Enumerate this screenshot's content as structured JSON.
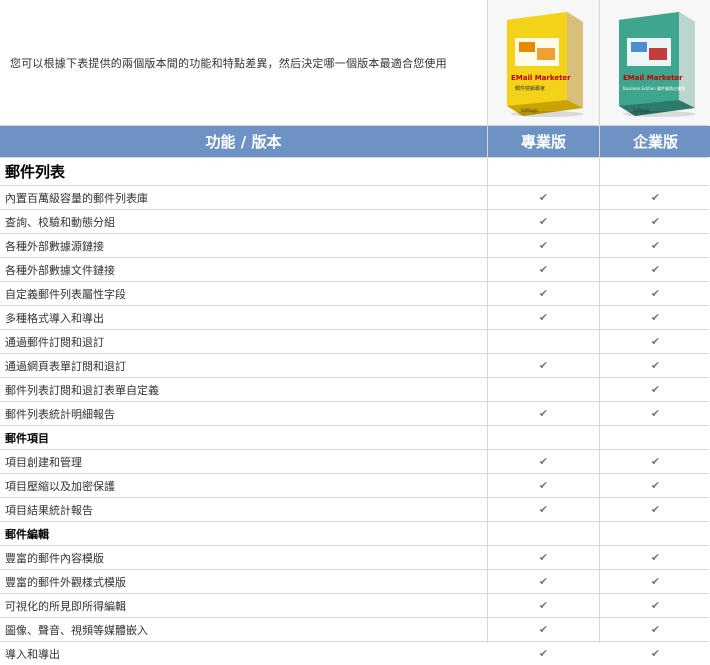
{
  "intro": "您可以根據下表提供的兩個版本間的功能和特點差異，然后決定哪一個版本最適合您使用",
  "products": [
    {
      "brand": "EMail Marketer",
      "subtitle": "郵件營銷專家",
      "vendor": "Softlogic",
      "theme": "yellow"
    },
    {
      "brand": "EMail Marketer",
      "subtitle": "Business Edition 郵件營銷企業版",
      "vendor": "Softlogic",
      "theme": "teal"
    }
  ],
  "header": {
    "feature_col": "功能 / 版本",
    "pro_col": "專業版",
    "biz_col": "企業版"
  },
  "sections": [
    {
      "title": "郵件列表",
      "big": true,
      "rows": [
        {
          "label": "內置百萬級容量的郵件列表庫",
          "pro": "✔",
          "biz": "✔"
        },
        {
          "label": "查詢、校驗和動態分組",
          "pro": "✔",
          "biz": "✔"
        },
        {
          "label": "各種外部數據源鏈接",
          "pro": "✔",
          "biz": "✔"
        },
        {
          "label": "各種外部數據文件鏈接",
          "pro": "✔",
          "biz": "✔"
        },
        {
          "label": "自定義郵件列表屬性字段",
          "pro": "✔",
          "biz": "✔"
        },
        {
          "label": "多種格式導入和導出",
          "pro": "✔",
          "biz": "✔"
        },
        {
          "label": "通過郵件訂閱和退訂",
          "pro": "",
          "biz": "✔"
        },
        {
          "label": "通過網頁表單訂閱和退訂",
          "pro": "✔",
          "biz": "✔"
        },
        {
          "label": "郵件列表訂閱和退訂表單自定義",
          "pro": "",
          "biz": "✔"
        },
        {
          "label": "郵件列表統計明細報告",
          "pro": "✔",
          "biz": "✔"
        }
      ]
    },
    {
      "title": "郵件項目",
      "big": false,
      "rows": [
        {
          "label": "項目創建和管理",
          "pro": "✔",
          "biz": "✔"
        },
        {
          "label": "項目壓縮以及加密保護",
          "pro": "✔",
          "biz": "✔"
        },
        {
          "label": "項目結果統計報告",
          "pro": "✔",
          "biz": "✔"
        }
      ]
    },
    {
      "title": "郵件編輯",
      "big": false,
      "rows": [
        {
          "label": "豐富的郵件內容模版",
          "pro": "✔",
          "biz": "✔"
        },
        {
          "label": "豐富的郵件外觀樣式模版",
          "pro": "✔",
          "biz": "✔"
        },
        {
          "label": "可視化的所見即所得編輯",
          "pro": "✔",
          "biz": "✔"
        },
        {
          "label": "圖像、聲音、視頻等媒體嵌入",
          "pro": "✔",
          "biz": "✔"
        },
        {
          "label": "導入和導出",
          "pro": "✔",
          "biz": "✔"
        }
      ]
    }
  ]
}
